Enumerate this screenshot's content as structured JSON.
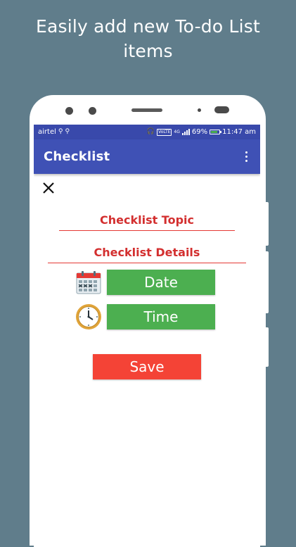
{
  "promo": {
    "line1": "Easily add new To-do List",
    "line2": "items"
  },
  "status_bar": {
    "carrier": "airtel",
    "usb_icons": [
      "usb-icon",
      "usb-icon"
    ],
    "headset_icon": "headphones-icon",
    "volte": "VoLTE",
    "network": "4G",
    "battery_percent": "69%",
    "battery_level": 0.69,
    "battery_color": "#4caf50",
    "time": "11:47 am"
  },
  "app_bar": {
    "title": "Checklist",
    "color": "#3f51b5",
    "overflow_icon": "more-vertical-icon"
  },
  "form": {
    "close_icon": "close-icon",
    "topic_placeholder": "Checklist Topic",
    "details_placeholder": "Checklist Details",
    "field_color": "#d32f2f",
    "date_icon": "calendar-icon",
    "date_label": "Date",
    "time_icon": "clock-icon",
    "time_label": "Time",
    "button_color": "#4caf50",
    "save_label": "Save",
    "save_color": "#f44336"
  }
}
